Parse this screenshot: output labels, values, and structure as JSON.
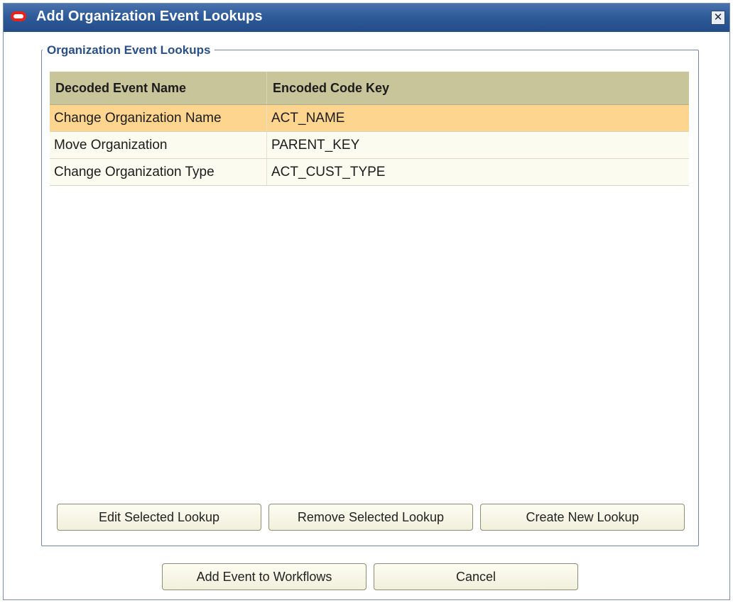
{
  "window": {
    "title": "Add Organization Event Lookups",
    "close_glyph": "✕",
    "icons": [
      "oracle-logo-icon",
      "close-icon"
    ],
    "colors": {
      "titlebar": "#2f5b9a",
      "group_border": "#6f86a8",
      "header_bg": "#c9c59b",
      "row_bg": "#fbfbef",
      "selected_row_bg": "#fdd58f"
    }
  },
  "group": {
    "legend": "Organization Event Lookups"
  },
  "table": {
    "columns": [
      "Decoded Event Name",
      "Encoded Code Key"
    ],
    "rows": [
      {
        "name": "Change Organization Name",
        "key": "ACT_NAME",
        "selected": true
      },
      {
        "name": "Move Organization",
        "key": "PARENT_KEY",
        "selected": false
      },
      {
        "name": "Change Organization Type",
        "key": "ACT_CUST_TYPE",
        "selected": false
      }
    ]
  },
  "lookup_buttons": {
    "edit": "Edit Selected Lookup",
    "remove": "Remove Selected Lookup",
    "create": "Create New Lookup"
  },
  "dialog_buttons": {
    "add": "Add Event to Workflows",
    "cancel": "Cancel"
  }
}
